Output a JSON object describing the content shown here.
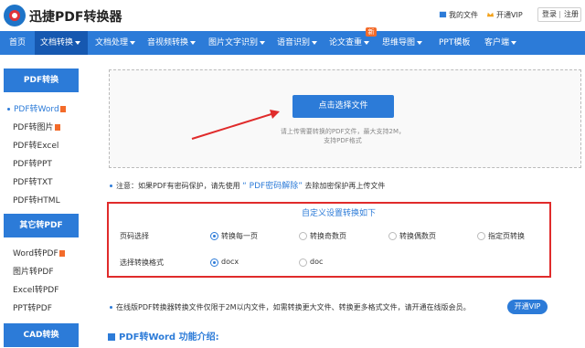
{
  "header": {
    "logo_text": "迅捷PDF转换器",
    "my_files": "我的文件",
    "vip": "开通VIP",
    "login": "登录",
    "separator": "|",
    "register": "注册"
  },
  "nav": {
    "items": [
      {
        "label": "首页",
        "dropdown": false
      },
      {
        "label": "文档转换",
        "dropdown": true
      },
      {
        "label": "文档处理",
        "dropdown": true
      },
      {
        "label": "音视频转换",
        "dropdown": true
      },
      {
        "label": "图片文字识别",
        "dropdown": true
      },
      {
        "label": "语音识别",
        "dropdown": true
      },
      {
        "label": "论文查重",
        "dropdown": true
      },
      {
        "label": "思维导图",
        "dropdown": true
      },
      {
        "label": "PPT模板",
        "dropdown": false
      },
      {
        "label": "客户端",
        "dropdown": true
      }
    ],
    "new_badge": "新"
  },
  "sidebar": {
    "groups": [
      {
        "title": "PDF转换",
        "items": [
          "PDF转Word",
          "PDF转图片",
          "PDF转Excel",
          "PDF转PPT",
          "PDF转TXT",
          "PDF转HTML"
        ]
      },
      {
        "title": "其它转PDF",
        "items": [
          "Word转PDF",
          "图片转PDF",
          "Excel转PDF",
          "PPT转PDF"
        ]
      },
      {
        "title": "CAD转换",
        "items": []
      }
    ]
  },
  "upload": {
    "button": "点击选择文件",
    "tip_line1": "请上传需要转换的PDF文件，最大支持2M，",
    "tip_line2": "支持PDF格式"
  },
  "notice": {
    "prefix": "注意：如果PDF有密码保护，请先使用",
    "link": "“ PDF密码解除”",
    "suffix": "去除加密保护再上传文件"
  },
  "settings": {
    "title": "自定义设置转换如下",
    "page_label": "页码选择",
    "page_options": [
      "转换每一页",
      "转换奇数页",
      "转换偶数页",
      "指定页转换"
    ],
    "page_selected": 0,
    "format_label": "选择转换格式",
    "format_options": [
      "docx",
      "doc"
    ],
    "format_selected": 0
  },
  "bottom": {
    "note": "在线版PDF转换器转换文件仅限于2M以内文件，如需转换更大文件、转换更多格式文件，请开通在线版会员。",
    "vip_button": "开通VIP"
  },
  "intro": {
    "title": "PDF转Word 功能介绍:"
  },
  "colors": {
    "brand_blue": "#2c7bd8",
    "nav_active": "#1658b0",
    "highlight_red": "#e02b2b",
    "badge_orange": "#f36b2a"
  }
}
